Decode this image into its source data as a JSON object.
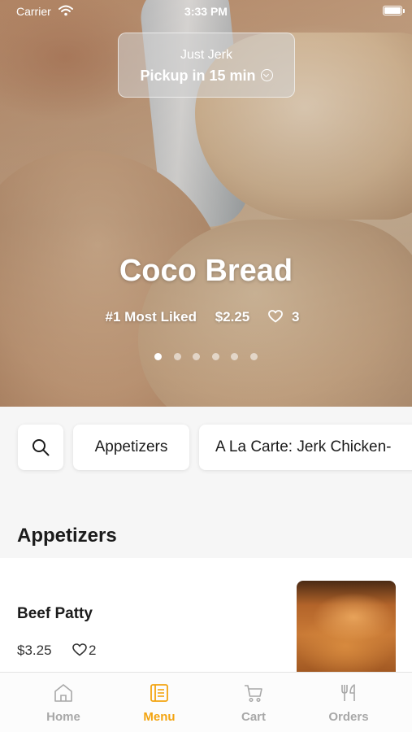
{
  "status_bar": {
    "carrier": "Carrier",
    "time": "3:33 PM"
  },
  "pickup": {
    "store": "Just Jerk",
    "label": "Pickup in 15 min"
  },
  "featured": {
    "title": "Coco Bread",
    "badge": "#1 Most Liked",
    "price": "$2.25",
    "likes": "3",
    "carousel_count": 6,
    "carousel_active_index": 0
  },
  "categories": {
    "items": [
      "Appetizers",
      "A La Carte: Jerk Chicken-"
    ]
  },
  "section": {
    "title": "Appetizers"
  },
  "menu_items": [
    {
      "name": "Beef Patty",
      "price": "$3.25",
      "likes": "2"
    }
  ],
  "tab_bar": {
    "tabs": [
      {
        "label": "Home",
        "icon": "home-icon"
      },
      {
        "label": "Menu",
        "icon": "menu-book-icon"
      },
      {
        "label": "Cart",
        "icon": "cart-icon"
      },
      {
        "label": "Orders",
        "icon": "fork-knife-icon"
      }
    ],
    "active": "Menu"
  },
  "colors": {
    "accent": "#f3a410",
    "inactive_tab": "#a8a8a8",
    "page_background": "#f6f6f6"
  }
}
